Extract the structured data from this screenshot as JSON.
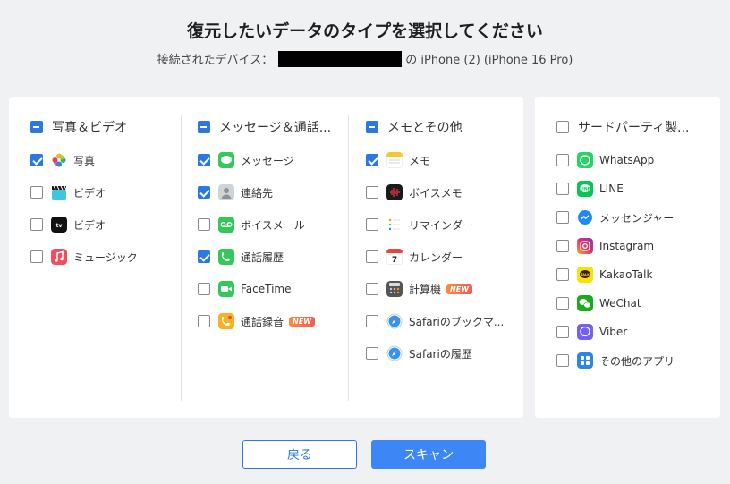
{
  "header": {
    "title": "復元したいデータのタイプを選択してください",
    "device_prefix": "接続されたデバイス：",
    "device_suffix": "の iPhone (2) (iPhone 16 Pro)"
  },
  "columns": [
    {
      "header": "写真＆ビデオ",
      "state": "partial",
      "items": [
        {
          "label": "写真",
          "checked": true,
          "icon": "photos-icon"
        },
        {
          "label": "ビデオ",
          "checked": false,
          "icon": "clapper-icon"
        },
        {
          "label": "ビデオ",
          "checked": false,
          "icon": "apple-tv-icon"
        },
        {
          "label": "ミュージック",
          "checked": false,
          "icon": "music-icon"
        }
      ]
    },
    {
      "header": "メッセージ＆通話...",
      "state": "partial",
      "items": [
        {
          "label": "メッセージ",
          "checked": true,
          "icon": "messages-icon"
        },
        {
          "label": "連絡先",
          "checked": true,
          "icon": "contacts-icon"
        },
        {
          "label": "ボイスメール",
          "checked": false,
          "icon": "voicemail-icon"
        },
        {
          "label": "通話履歴",
          "checked": true,
          "icon": "phone-icon"
        },
        {
          "label": "FaceTime",
          "checked": false,
          "icon": "facetime-icon"
        },
        {
          "label": "通話録音",
          "checked": false,
          "icon": "call-recording-icon",
          "badge": "NEW"
        }
      ]
    },
    {
      "header": "メモとその他",
      "state": "partial",
      "items": [
        {
          "label": "メモ",
          "checked": true,
          "icon": "notes-icon"
        },
        {
          "label": "ボイスメモ",
          "checked": false,
          "icon": "voice-memo-icon"
        },
        {
          "label": "リマインダー",
          "checked": false,
          "icon": "reminders-icon"
        },
        {
          "label": "カレンダー",
          "checked": false,
          "icon": "calendar-icon"
        },
        {
          "label": "計算機",
          "checked": false,
          "icon": "calculator-icon",
          "badge": "NEW"
        },
        {
          "label": "Safariのブックマ...",
          "checked": false,
          "icon": "safari-icon"
        },
        {
          "label": "Safariの履歴",
          "checked": false,
          "icon": "safari-icon"
        }
      ]
    }
  ],
  "side": {
    "header": "サードパーティ製...",
    "state": "unchecked",
    "items": [
      {
        "label": "WhatsApp",
        "checked": false,
        "icon": "whatsapp-icon"
      },
      {
        "label": "LINE",
        "checked": false,
        "icon": "line-icon"
      },
      {
        "label": "メッセンジャー",
        "checked": false,
        "icon": "messenger-icon"
      },
      {
        "label": "Instagram",
        "checked": false,
        "icon": "instagram-icon"
      },
      {
        "label": "KakaoTalk",
        "checked": false,
        "icon": "kakaotalk-icon"
      },
      {
        "label": "WeChat",
        "checked": false,
        "icon": "wechat-icon"
      },
      {
        "label": "Viber",
        "checked": false,
        "icon": "viber-icon"
      },
      {
        "label": "その他のアプリ",
        "checked": false,
        "icon": "other-apps-icon"
      }
    ]
  },
  "buttons": {
    "back": "戻る",
    "scan": "スキャン"
  },
  "colors": {
    "accent": "#2b78e4",
    "scan_button": "#3d86f5"
  }
}
